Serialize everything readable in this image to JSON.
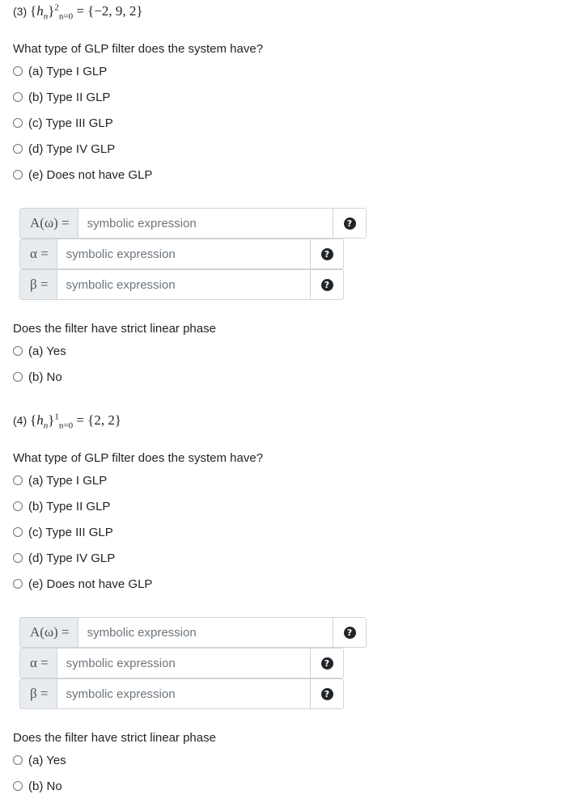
{
  "problems": [
    {
      "number": "(3)",
      "seq_var": "h",
      "seq_sub": "n",
      "upper": "2",
      "lower": "n=0",
      "values": "{−2, 9, 2}",
      "glp_question": "What type of GLP filter does the system have?",
      "glp_options": [
        "(a) Type I GLP",
        "(b) Type II GLP",
        "(c) Type III GLP",
        "(d) Type IV GLP",
        "(e) Does not have GLP"
      ],
      "amplitude_label": "A(ω) =",
      "alpha_label": "α =",
      "beta_label": "β =",
      "placeholder": "symbolic expression",
      "linear_question": "Does the filter have strict linear phase",
      "linear_options": [
        "(a) Yes",
        "(b) No"
      ]
    },
    {
      "number": "(4)",
      "seq_var": "h",
      "seq_sub": "n",
      "upper": "1",
      "lower": "n=0",
      "values": "{2, 2}",
      "glp_question": "What type of GLP filter does the system have?",
      "glp_options": [
        "(a) Type I GLP",
        "(b) Type II GLP",
        "(c) Type III GLP",
        "(d) Type IV GLP",
        "(e) Does not have GLP"
      ],
      "amplitude_label": "A(ω) =",
      "alpha_label": "α =",
      "beta_label": "β =",
      "placeholder": "symbolic expression",
      "linear_question": "Does the filter have strict linear phase",
      "linear_options": [
        "(a) Yes",
        "(b) No"
      ]
    }
  ],
  "help_icon_glyph": "?"
}
